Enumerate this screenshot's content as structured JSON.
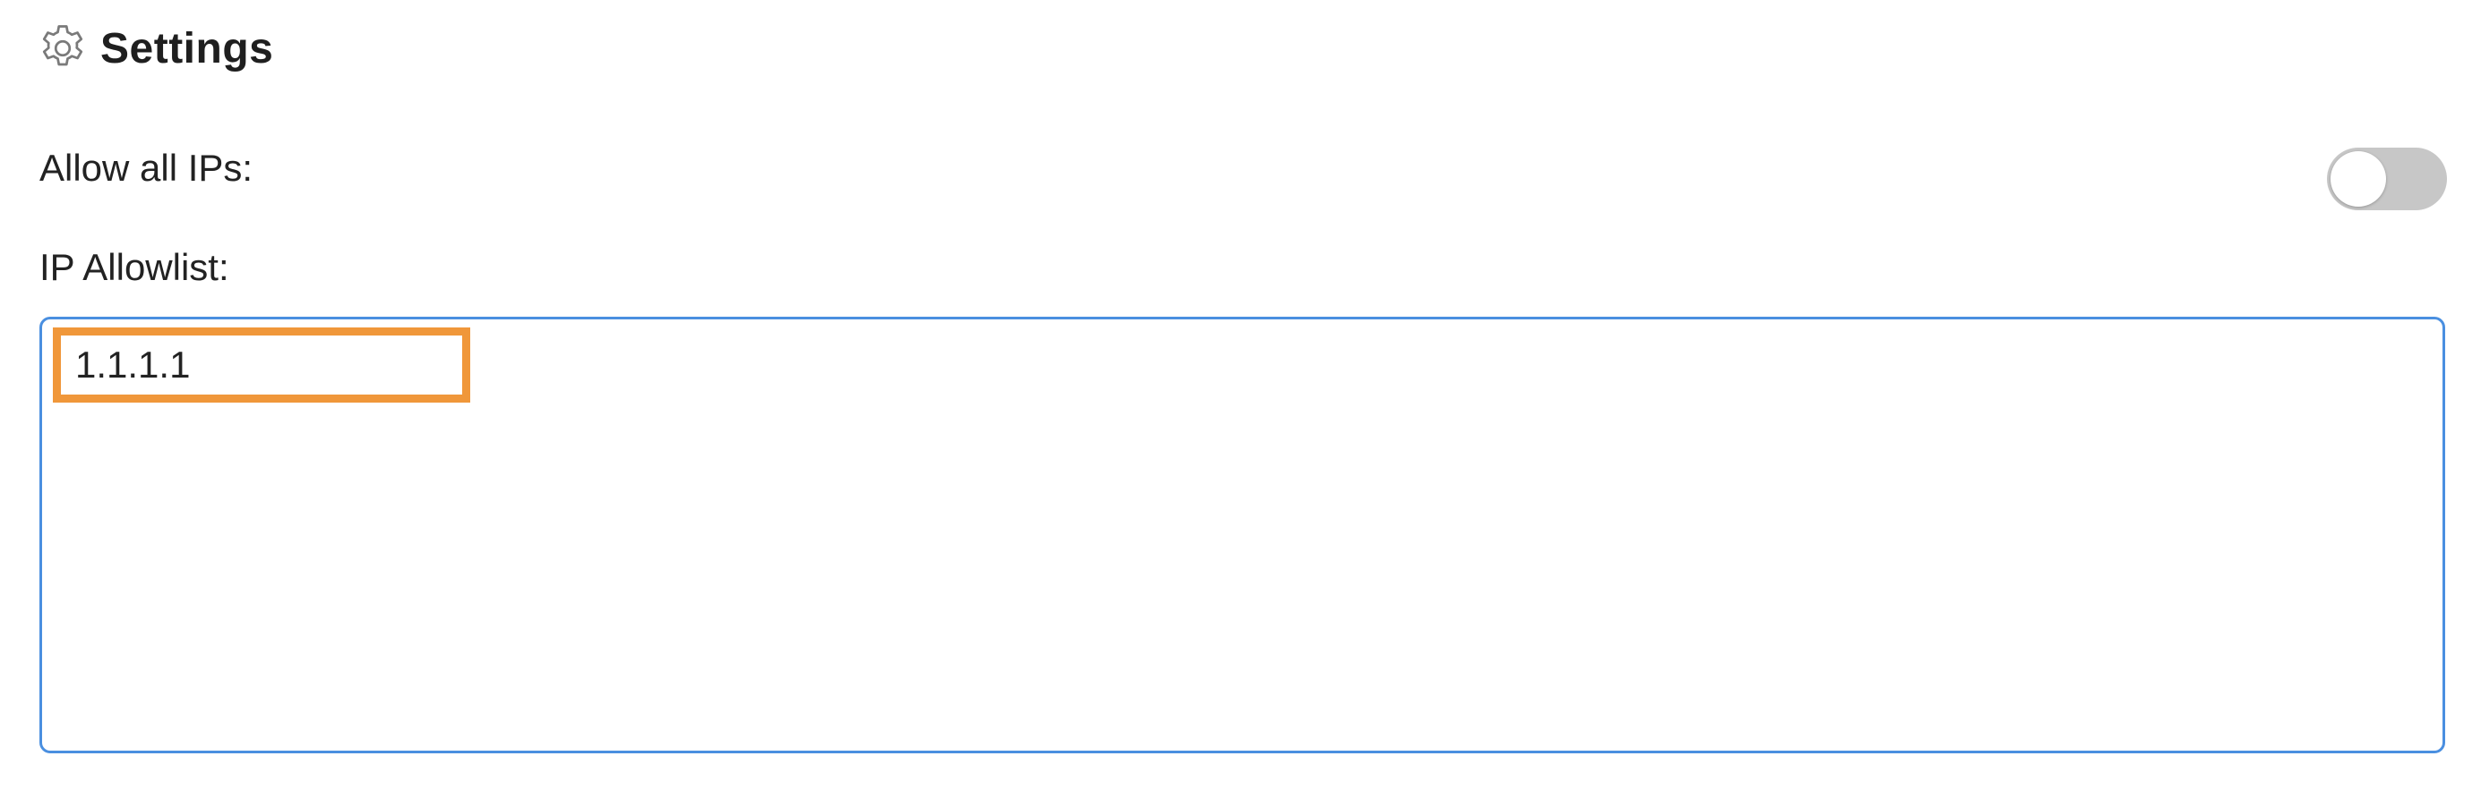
{
  "header": {
    "title": "Settings",
    "icon": "gear-icon"
  },
  "allow_all_ips": {
    "label": "Allow all IPs:",
    "enabled": false
  },
  "ip_allowlist": {
    "label": "IP Allowlist:",
    "entries": [
      "1.1.1.1"
    ]
  },
  "colors": {
    "input_border": "#4a8fe0",
    "highlight": "#f0973a",
    "toggle_off": "#c7c7c7"
  }
}
